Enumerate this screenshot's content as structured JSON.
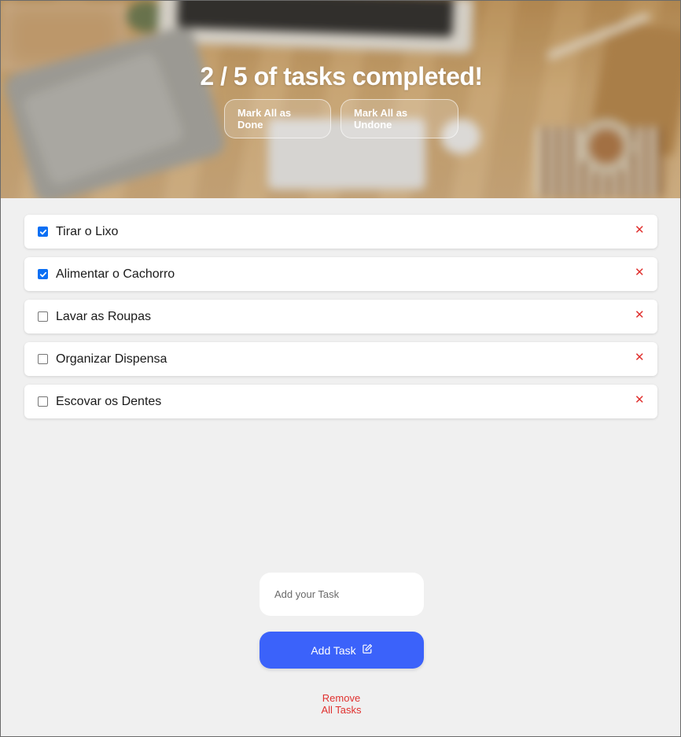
{
  "header": {
    "completed_count": "2",
    "total_text": "/ 5 of tasks completed!",
    "mark_all_done_label": "Mark All as Done",
    "mark_all_undone_label": "Mark All as Undone"
  },
  "tasks": [
    {
      "label": "Tirar o Lixo",
      "done": true
    },
    {
      "label": "Alimentar o Cachorro",
      "done": true
    },
    {
      "label": "Lavar as Roupas",
      "done": false
    },
    {
      "label": "Organizar Dispensa",
      "done": false
    },
    {
      "label": "Escovar os Dentes",
      "done": false
    }
  ],
  "delete_icon": "close-icon",
  "add_form": {
    "input_placeholder": "Add your Task",
    "input_value": "",
    "add_button_label": "Add Task",
    "add_button_icon": "edit-icon"
  },
  "remove_all": {
    "line1": "Remove",
    "line2": "All Tasks"
  },
  "colors": {
    "accent": "#3b62fa",
    "danger": "#e0312f",
    "checkbox_checked": "#0b6ff4",
    "page_bg": "#f0f0f0"
  }
}
